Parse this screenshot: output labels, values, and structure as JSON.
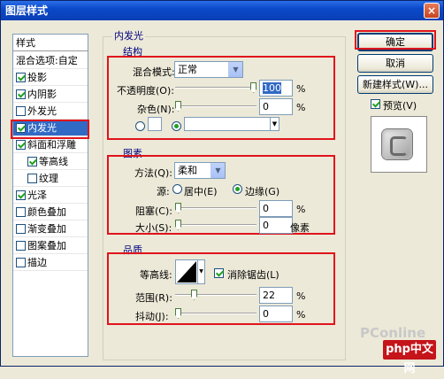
{
  "window": {
    "title": "图层样式",
    "close": "×"
  },
  "left_panel": {
    "header": "样式",
    "items": [
      {
        "label": "混合选项:自定",
        "checked": null
      },
      {
        "label": "投影",
        "checked": true
      },
      {
        "label": "内阴影",
        "checked": true
      },
      {
        "label": "外发光",
        "checked": false
      },
      {
        "label": "内发光",
        "checked": true,
        "selected": true
      },
      {
        "label": "斜面和浮雕",
        "checked": true
      },
      {
        "label": "等高线",
        "checked": true,
        "sub": true
      },
      {
        "label": "纹理",
        "checked": false,
        "sub": true
      },
      {
        "label": "光泽",
        "checked": true
      },
      {
        "label": "颜色叠加",
        "checked": false
      },
      {
        "label": "渐变叠加",
        "checked": false
      },
      {
        "label": "图案叠加",
        "checked": false
      },
      {
        "label": "描边",
        "checked": false
      }
    ]
  },
  "panel_title": "内发光",
  "structure": {
    "title": "结构",
    "blend_mode_label": "混合模式:",
    "blend_mode_value": "正常",
    "opacity_label": "不透明度(O):",
    "opacity_value": "100",
    "opacity_unit": "%",
    "noise_label": "杂色(N):",
    "noise_value": "0",
    "noise_unit": "%"
  },
  "elements": {
    "title": "图素",
    "method_label": "方法(Q):",
    "method_value": "柔和",
    "source_label": "源:",
    "source_center": "居中(E)",
    "source_edge": "边缘(G)",
    "choke_label": "阻塞(C):",
    "choke_value": "0",
    "choke_unit": "%",
    "size_label": "大小(S):",
    "size_value": "0",
    "size_unit": "像素"
  },
  "quality": {
    "title": "品质",
    "contour_label": "等高线:",
    "antialias_label": "消除锯齿(L)",
    "range_label": "范围(R):",
    "range_value": "22",
    "range_unit": "%",
    "jitter_label": "抖动(J):",
    "jitter_value": "0",
    "jitter_unit": "%"
  },
  "buttons": {
    "ok": "确定",
    "cancel": "取消",
    "new_style": "新建样式(W)...",
    "preview": "预览(V)"
  },
  "watermark": {
    "site": "PConline",
    "brand": "php中文网"
  },
  "colors": {
    "highlight_red": "#e0141c",
    "selection": "#316ac5",
    "title_blue": "#0b49c8"
  }
}
